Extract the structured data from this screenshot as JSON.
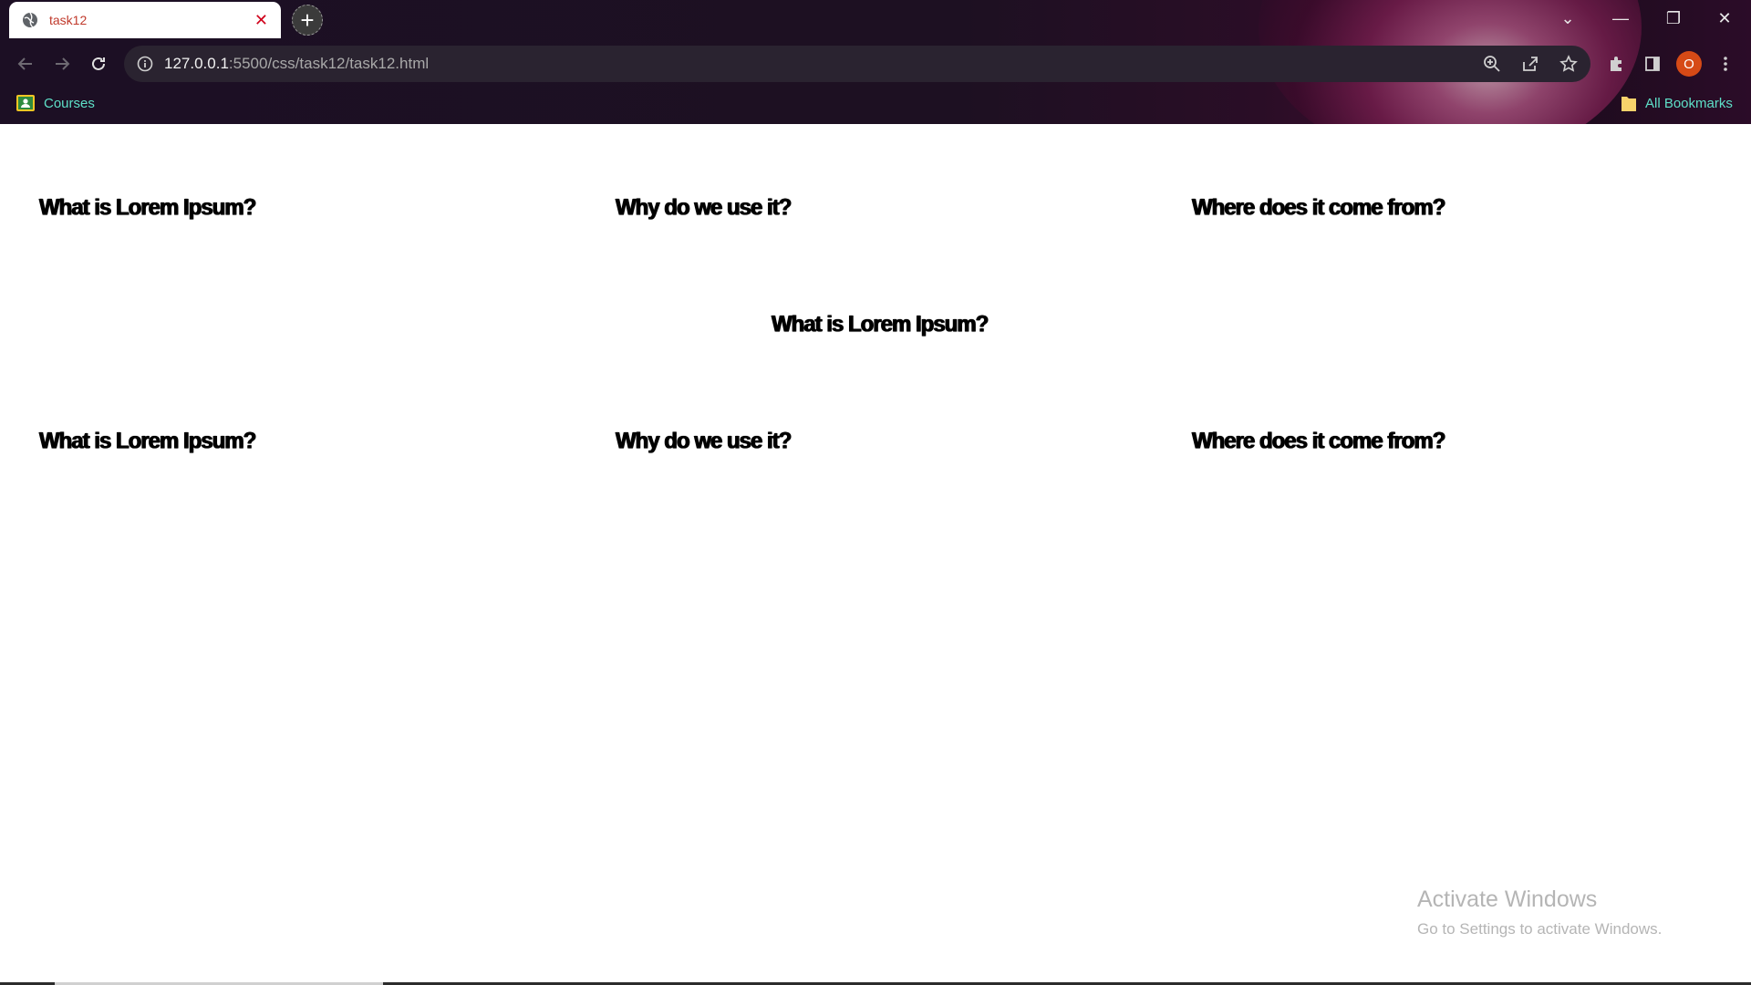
{
  "browser": {
    "tab_title": "task12",
    "url_host": "127.0.0.1",
    "url_path": ":5500/css/task12/task12.html",
    "profile_initial": "O"
  },
  "bookmarks": {
    "left_label": "Courses",
    "right_label": "All Bookmarks"
  },
  "page": {
    "row1": [
      "What is Lorem Ipsum?",
      "Why do we use it?",
      "Where does it come from?"
    ],
    "center": "What is Lorem Ipsum?",
    "row2": [
      "What is Lorem Ipsum?",
      "Why do we use it?",
      "Where does it come from?"
    ]
  },
  "watermark": {
    "title": "Activate Windows",
    "subtitle": "Go to Settings to activate Windows."
  },
  "colors": {
    "tab_text": "#c0392b",
    "bookmark_text": "#5ee0c8",
    "avatar": "#d64a16"
  }
}
